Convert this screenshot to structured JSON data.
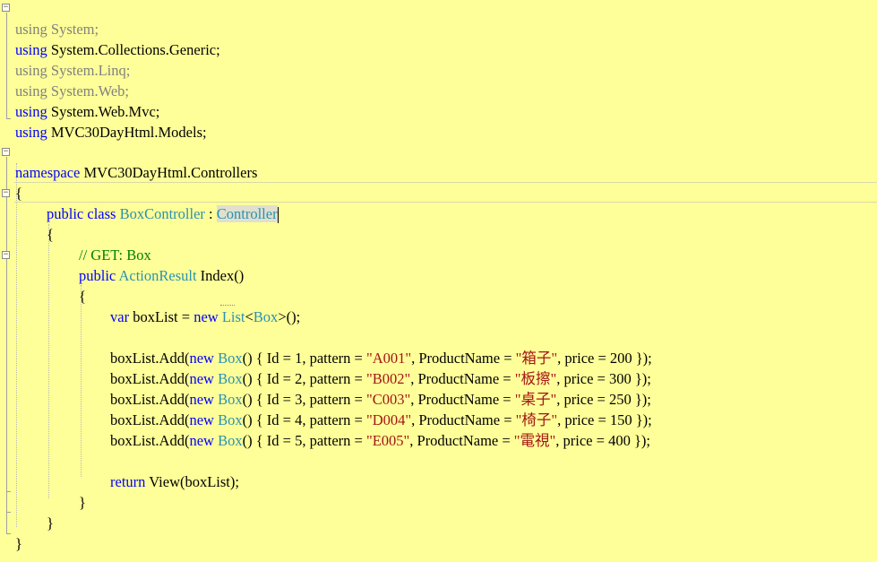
{
  "editor": {
    "colors": {
      "background": "#ffff99",
      "keyword": "#0000ff",
      "type": "#2b91af",
      "string": "#a31515",
      "comment": "#008000",
      "dimmed": "#808080"
    },
    "usings": [
      {
        "kw": "using",
        "ns": "System;",
        "dimmed": true
      },
      {
        "kw": "using",
        "ns": "System.Collections.Generic;",
        "dimmed": false
      },
      {
        "kw": "using",
        "ns": "System.Linq;",
        "dimmed": true
      },
      {
        "kw": "using",
        "ns": "System.Web;",
        "dimmed": true
      },
      {
        "kw": "using",
        "ns": "System.Web.Mvc;",
        "dimmed": false
      },
      {
        "kw": "using",
        "ns": "MVC30DayHtml.Models;",
        "dimmed": false
      }
    ],
    "namespace": {
      "kw": "namespace",
      "name": "MVC30DayHtml.Controllers"
    },
    "open_brace": "{",
    "close_brace": "}",
    "class_decl": {
      "kw_public": "public",
      "kw_class": "class",
      "name": "BoxController",
      "colon": ":",
      "base": "Controller"
    },
    "comment": "// GET: Box",
    "method_decl": {
      "kw_public": "public",
      "return_type": "ActionResult",
      "name": "Index()"
    },
    "var_decl": {
      "kw_var": "var",
      "ident": "boxList =",
      "kw_new": "new",
      "type_list": "List",
      "lt": "<",
      "type_box": "Box",
      "tail": ">();"
    },
    "adds": [
      {
        "id": "1",
        "pattern": "\"A001\"",
        "name": "\"箱子\"",
        "price": "200"
      },
      {
        "id": "2",
        "pattern": "\"B002\"",
        "name": "\"板擦\"",
        "price": "300"
      },
      {
        "id": "3",
        "pattern": "\"C003\"",
        "name": "\"桌子\"",
        "price": "250"
      },
      {
        "id": "4",
        "pattern": "\"D004\"",
        "name": "\"椅子\"",
        "price": "150"
      },
      {
        "id": "5",
        "pattern": "\"E005\"",
        "name": "\"電視\"",
        "price": "400"
      }
    ],
    "add_parts": {
      "call": "boxList.Add(",
      "kw_new": "new",
      "type_box": "Box",
      "open": "() { Id = ",
      "pattern_label": ", pattern = ",
      "name_label": ", ProductName = ",
      "price_label": ", price = ",
      "close": " });"
    },
    "return_stmt": {
      "kw_return": "return",
      "rest": "View(boxList);"
    }
  }
}
